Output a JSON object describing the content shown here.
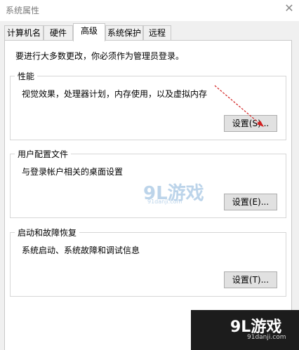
{
  "window": {
    "title": "系统属性"
  },
  "tabs": [
    {
      "label": "计算机名"
    },
    {
      "label": "硬件"
    },
    {
      "label": "高级"
    },
    {
      "label": "系统保护"
    },
    {
      "label": "远程"
    }
  ],
  "intro": "要进行大多数更改，你必须作为管理员登录。",
  "groups": {
    "performance": {
      "title": "性能",
      "desc": "视觉效果，处理器计划，内存使用，以及虚拟内存",
      "button": "设置(S)..."
    },
    "profile": {
      "title": "用户配置文件",
      "desc": "与登录帐户相关的桌面设置",
      "button": "设置(E)..."
    },
    "startup": {
      "title": "启动和故障恢复",
      "desc": "系统启动、系统故障和调试信息",
      "button": "设置(T)..."
    }
  },
  "watermark": {
    "text": "9L游戏",
    "sub": "91danji.com"
  },
  "icons": {
    "close": "close-icon"
  }
}
